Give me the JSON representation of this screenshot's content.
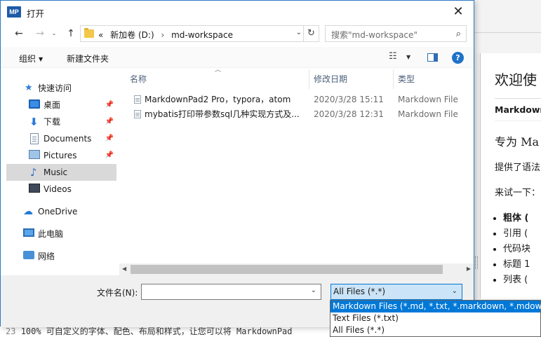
{
  "dialog": {
    "title": "打开",
    "app_icon_text": "MP",
    "close_glyph": "✕"
  },
  "nav": {
    "back_glyph": "←",
    "forward_glyph": "→",
    "recent_glyph": "⌄",
    "up_glyph": "↑",
    "address": {
      "prefix": "«",
      "segments": [
        "新加卷 (D:)",
        "md-workspace"
      ],
      "separator": "›"
    },
    "search_placeholder": "搜索\"md-workspace\"",
    "search_glyph": "⌕"
  },
  "commandbar": {
    "organize": "组织",
    "new_folder": "新建文件夹",
    "help_glyph": "?"
  },
  "sidebar": {
    "items": [
      {
        "label": "快速访问",
        "icon": "star-icon",
        "pinned": false
      },
      {
        "label": "桌面",
        "icon": "desktop-icon",
        "pinned": true
      },
      {
        "label": "下载",
        "icon": "download-icon",
        "pinned": true
      },
      {
        "label": "Documents",
        "icon": "documents-icon",
        "pinned": true
      },
      {
        "label": "Pictures",
        "icon": "pictures-icon",
        "pinned": true
      },
      {
        "label": "Music",
        "icon": "music-icon",
        "pinned": false,
        "selected": true
      },
      {
        "label": "Videos",
        "icon": "videos-icon",
        "pinned": false
      },
      {
        "label": "OneDrive",
        "icon": "onedrive-icon",
        "pinned": false
      },
      {
        "label": "此电脑",
        "icon": "computer-icon",
        "pinned": false
      },
      {
        "label": "网络",
        "icon": "network-icon",
        "pinned": false
      }
    ]
  },
  "filelist": {
    "columns": [
      "名称",
      "修改日期",
      "类型"
    ],
    "rows": [
      {
        "name": "MarkdownPad2 Pro，typora，atom",
        "date": "2020/3/28 15:11",
        "type": "Markdown File"
      },
      {
        "name": "mybatis打印带参数sql几种实现方式及...",
        "date": "2020/3/28 12:31",
        "type": "Markdown File"
      }
    ]
  },
  "footer": {
    "filename_label": "文件名(N):",
    "filename_value": "",
    "filetype_selected": "All Files (*.*)",
    "filetype_options": [
      "Markdown Files (*.md, *.txt, *.markdown, *.mdown)",
      "Text Files (*.txt)",
      "All Files (*.*)"
    ]
  },
  "background": {
    "preview": {
      "heading": "欢迎使",
      "subtitle": "Markdown",
      "heading2": "专为 Ma",
      "para1": "提供了语法",
      "para2": "来试一下：",
      "bullets": [
        "粗体 (",
        "引用 (",
        "代码块",
        "标题 1",
        "列表 ("
      ]
    },
    "editor_line_number": "23",
    "editor_line_text": "100% 可自定义的字体、配色、布局和样式，让您可以将 MarkdownPad"
  },
  "colors": {
    "accent": "#0078d7",
    "dialog_border": "#2b79c4",
    "selected_nav": "#d9d9d9",
    "select_bg": "#cce4f7"
  }
}
